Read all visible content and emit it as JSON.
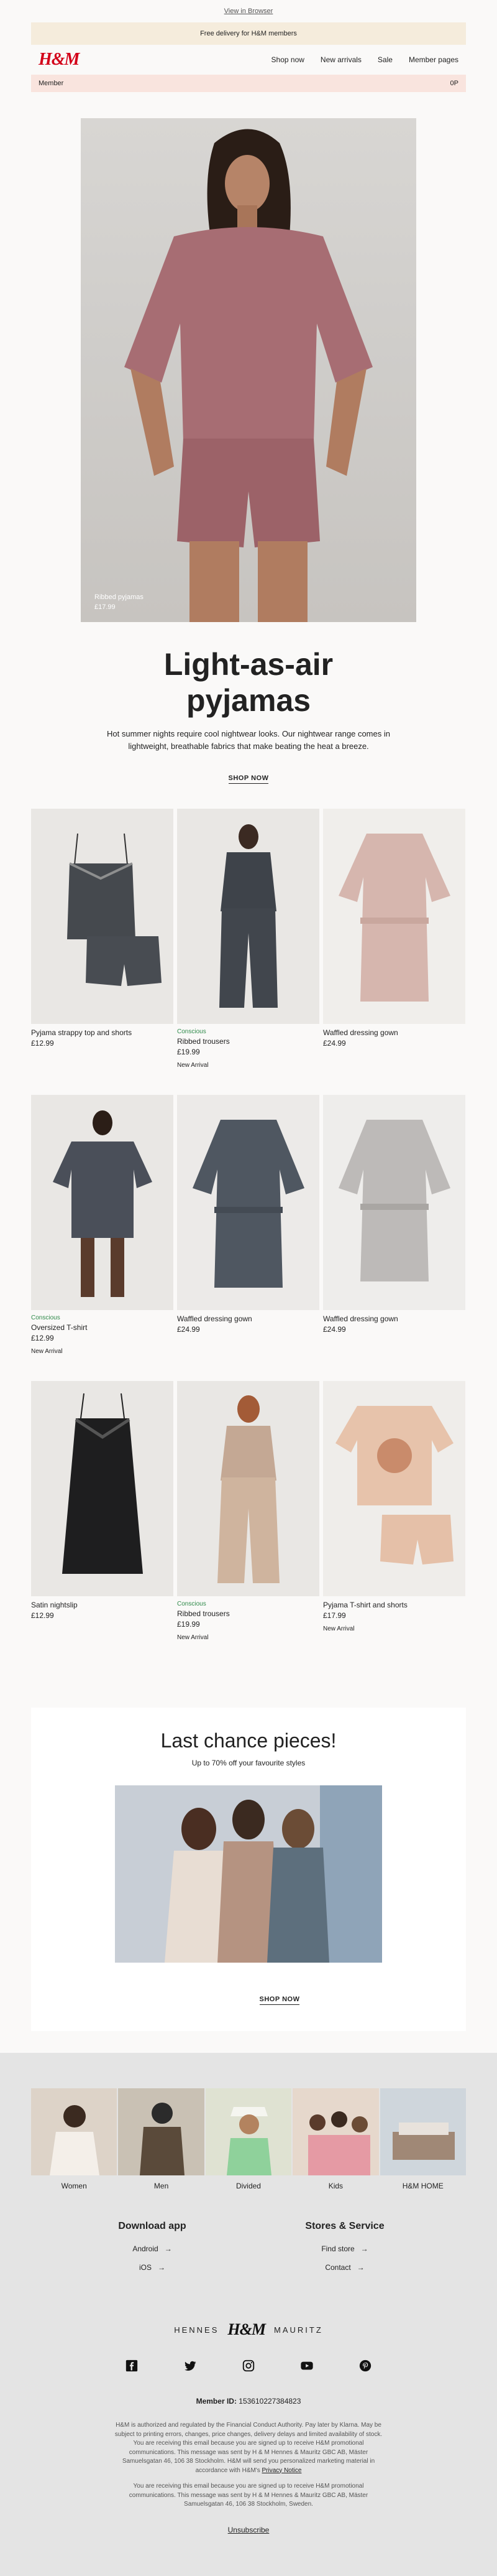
{
  "top": {
    "browser_link": "View in Browser"
  },
  "promo": {
    "text": "Free delivery for H&M members"
  },
  "header": {
    "logo": "H&M",
    "nav": [
      "Shop now",
      "New arrivals",
      "Sale",
      "Member pages"
    ]
  },
  "member_bar": {
    "label": "Member",
    "points": "0P"
  },
  "hero": {
    "caption_name": "Ribbed pyjamas",
    "caption_price": "£17.99",
    "title_line1": "Light-as-air",
    "title_line2": "pyjamas",
    "text": "Hot summer nights require cool nightwear looks. Our nightwear range comes in lightweight, breathable fabrics that make beating the heat a breeze.",
    "cta": "SHOP NOW"
  },
  "products": [
    {
      "name": "Pyjama strappy top and shorts",
      "price": "£12.99",
      "conscious": "",
      "badge": ""
    },
    {
      "name": "Ribbed trousers",
      "price": "£19.99",
      "conscious": "Conscious",
      "badge": "New Arrival"
    },
    {
      "name": "Waffled dressing gown",
      "price": "£24.99",
      "conscious": "",
      "badge": ""
    },
    {
      "name": "Oversized T-shirt",
      "price": "£12.99",
      "conscious": "Conscious",
      "badge": "New Arrival"
    },
    {
      "name": "Waffled dressing gown",
      "price": "£24.99",
      "conscious": "",
      "badge": ""
    },
    {
      "name": "Waffled dressing gown",
      "price": "£24.99",
      "conscious": "",
      "badge": ""
    },
    {
      "name": "Satin nightslip",
      "price": "£12.99",
      "conscious": "",
      "badge": ""
    },
    {
      "name": "Ribbed trousers",
      "price": "£19.99",
      "conscious": "Conscious",
      "badge": "New Arrival"
    },
    {
      "name": "Pyjama T-shirt and shorts",
      "price": "£17.99",
      "conscious": "",
      "badge": "New Arrival"
    }
  ],
  "last_chance": {
    "title": "Last chance pieces!",
    "subtitle": "Up to 70% off your favourite styles",
    "cta": "SHOP NOW"
  },
  "categories": [
    "Women",
    "Men",
    "Divided",
    "Kids",
    "H&M HOME"
  ],
  "download": {
    "title": "Download app",
    "links": [
      "Android",
      "iOS"
    ]
  },
  "stores": {
    "title": "Stores & Service",
    "links": [
      "Find store",
      "Contact"
    ]
  },
  "brand": {
    "left": "HENNES",
    "mid": "H&M",
    "right": "MAURITZ"
  },
  "social_icons": [
    "facebook-icon",
    "twitter-icon",
    "instagram-icon",
    "youtube-icon",
    "pinterest-icon"
  ],
  "member_id": {
    "label": "Member ID:",
    "value": "153610227384823"
  },
  "legal": {
    "text": "H&M is authorized and regulated by the Financial Conduct Authority. Pay later by Klarna. May be subject to printing errors, changes, price changes, delivery delays and limited availability of stock. You are receiving this email because you are signed up to receive H&M promotional communications. This message was sent by H & M Hennes & Mauritz GBC AB, Mäster Samuelsgatan 46, 106 38 Stockholm. H&M will send you personalized marketing material in accordance with H&M's",
    "privacy_link": "Privacy Notice",
    "text2": "You are receiving this email because you are signed up to receive H&M promotional communications. This message was sent by H & M Hennes & Mauritz GBC AB, Mäster Samuelsgatan 46, 106 38 Stockholm, Sweden."
  },
  "unsubscribe": "Unsubscribe",
  "colors": {
    "brand_red": "#d30019",
    "promo_bg": "#f5ecdc",
    "member_bg": "#f9e4de",
    "conscious_green": "#2f8a4a",
    "footer_bg": "#e4e4e4"
  }
}
